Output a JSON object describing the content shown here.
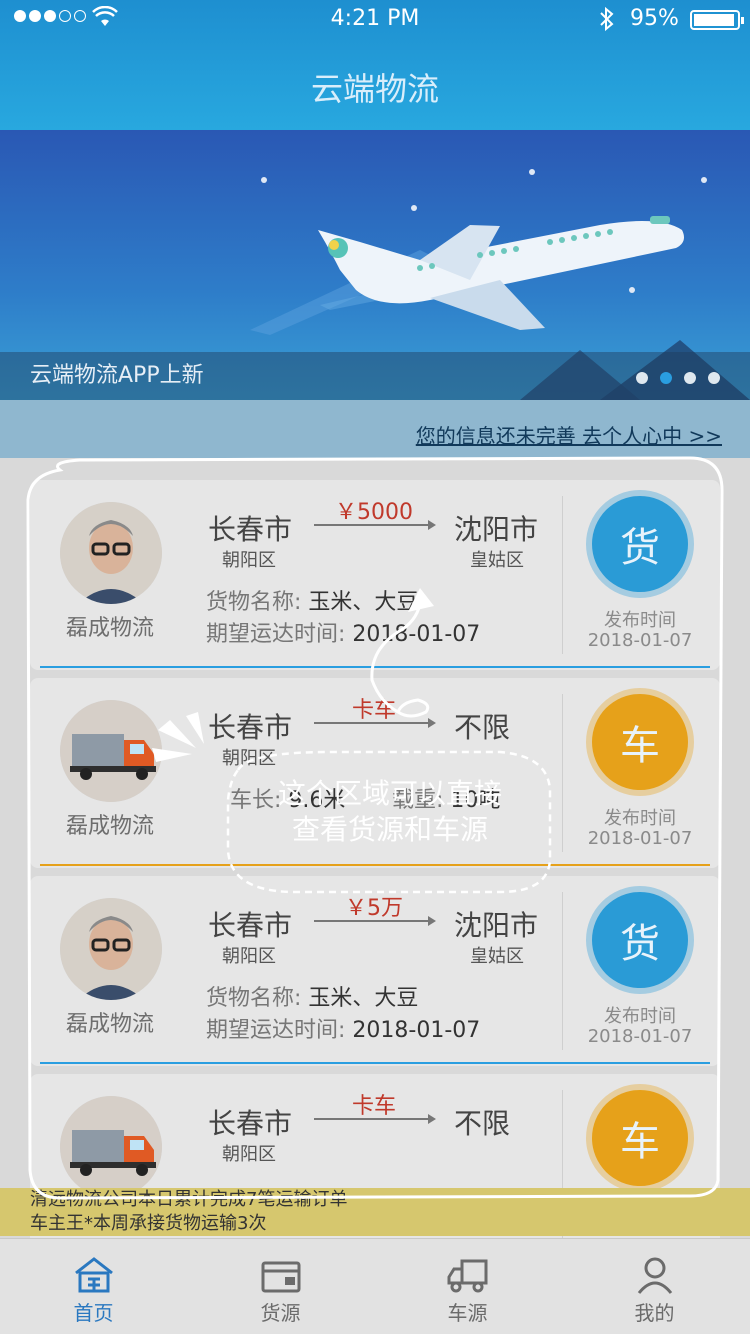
{
  "status": {
    "time": "4:21 PM",
    "battery": "95%"
  },
  "header": {
    "title": "云端物流"
  },
  "banner": {
    "caption": "云端物流APP上新"
  },
  "notice": {
    "link": "您的信息还未完善 去个人心中 >>"
  },
  "cards": [
    {
      "type": "goods",
      "badge": "货",
      "company": "磊成物流",
      "from_city": "长春市",
      "from_district": "朝阳区",
      "to_city": "沈阳市",
      "to_district": "皇姑区",
      "price": "￥5000",
      "info1_key": "货物名称:",
      "info1_val": "玉米、大豆",
      "info2_key": "期望运达时间:",
      "info2_val": "2018-01-07",
      "pub_label": "发布时间",
      "pub_date": "2018-01-07"
    },
    {
      "type": "truck",
      "badge": "车",
      "company": "磊成物流",
      "from_city": "长春市",
      "from_district": "朝阳区",
      "to_city": "不限",
      "to_district": "",
      "price": "卡车",
      "info1_key": "车长:",
      "info1_val": "9.6米",
      "info2_key": "载重:",
      "info2_val": "10吨",
      "pub_label": "发布时间",
      "pub_date": "2018-01-07"
    },
    {
      "type": "goods",
      "badge": "货",
      "company": "磊成物流",
      "from_city": "长春市",
      "from_district": "朝阳区",
      "to_city": "沈阳市",
      "to_district": "皇姑区",
      "price": "￥5万",
      "info1_key": "货物名称:",
      "info1_val": "玉米、大豆",
      "info2_key": "期望运达时间:",
      "info2_val": "2018-01-07",
      "pub_label": "发布时间",
      "pub_date": "2018-01-07"
    },
    {
      "type": "truck",
      "badge": "车",
      "company": "",
      "from_city": "长春市",
      "from_district": "朝阳区",
      "to_city": "不限",
      "to_district": "",
      "price": "卡车"
    }
  ],
  "ticker": {
    "line1": "清远物流公司本日累计完成7笔运输订单",
    "line2": "车主王*本周承接货物运输3次"
  },
  "overlay": {
    "hint_line1": "这个区域可以直接",
    "hint_line2": "查看货源和车源"
  },
  "tabs": [
    {
      "label": "首页",
      "icon": "home-icon",
      "active": true
    },
    {
      "label": "货源",
      "icon": "box-icon",
      "active": false
    },
    {
      "label": "车源",
      "icon": "truck-icon",
      "active": false
    },
    {
      "label": "我的",
      "icon": "user-icon",
      "active": false
    }
  ],
  "colors": {
    "primary": "#2a9ee0",
    "accent": "#e6a11a",
    "price": "#c0392b"
  }
}
